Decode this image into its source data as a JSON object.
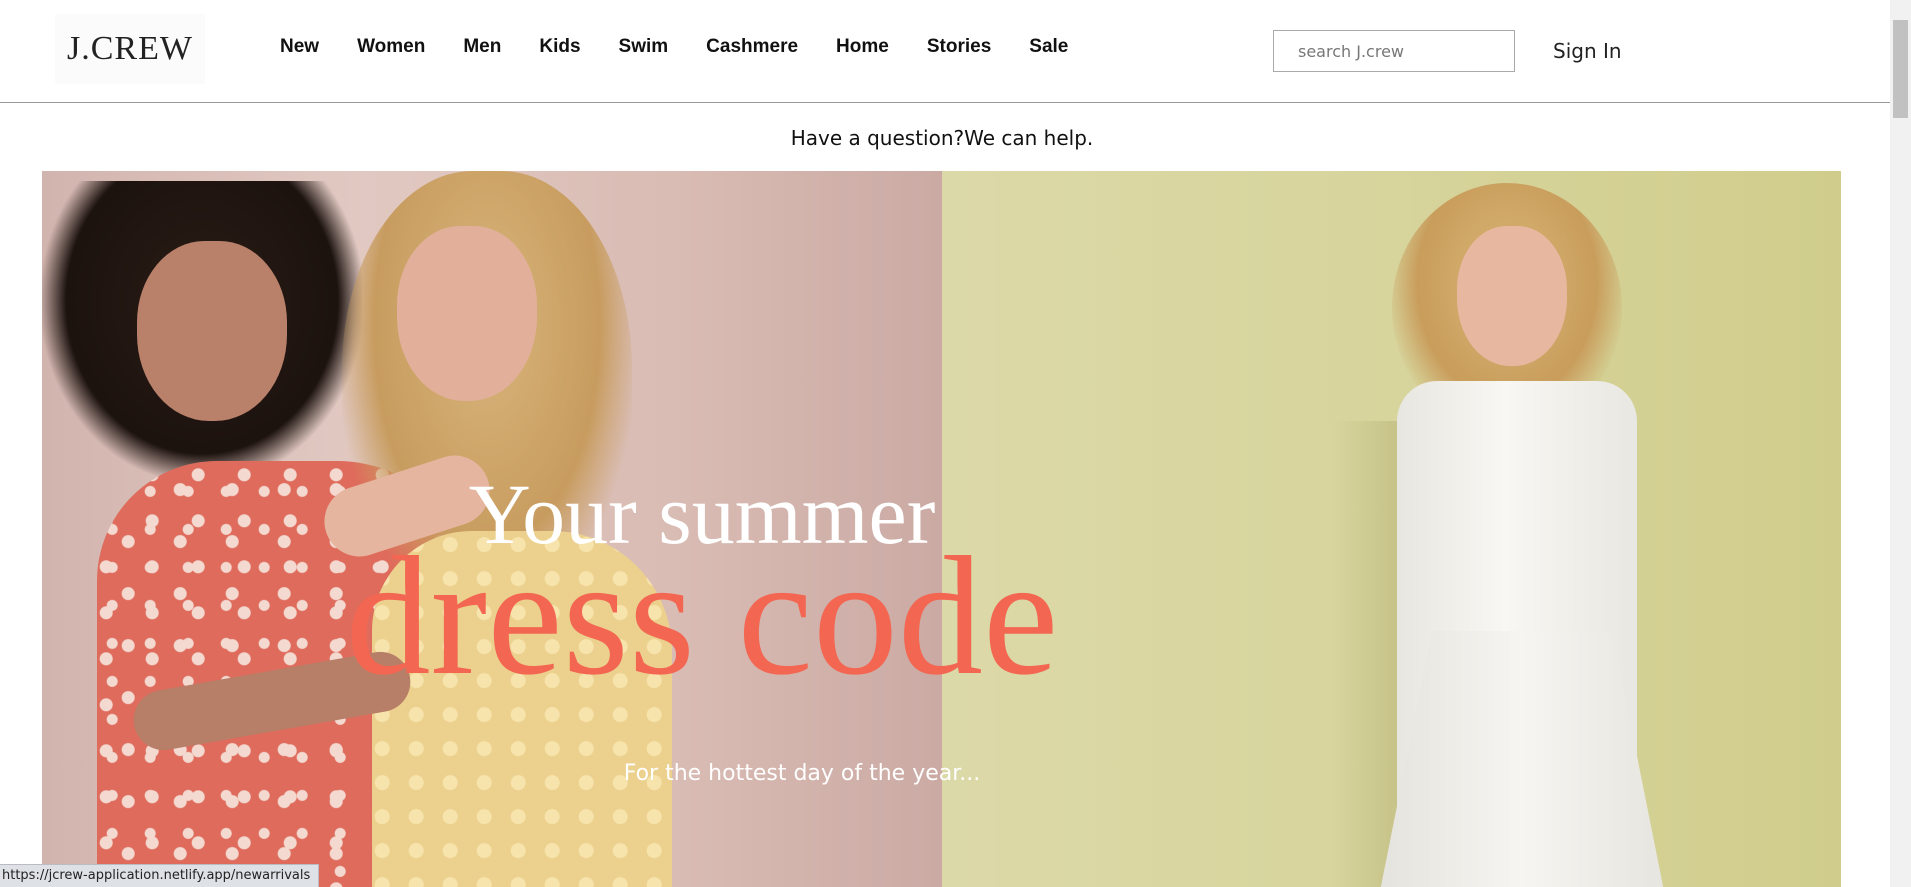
{
  "brand": {
    "logo_text": "J.CREW"
  },
  "nav": {
    "items": [
      {
        "label": "New"
      },
      {
        "label": "Women"
      },
      {
        "label": "Men"
      },
      {
        "label": "Kids"
      },
      {
        "label": "Swim"
      },
      {
        "label": "Cashmere"
      },
      {
        "label": "Home"
      },
      {
        "label": "Stories"
      },
      {
        "label": "Sale"
      }
    ]
  },
  "search": {
    "placeholder": "search J.crew",
    "value": ""
  },
  "account": {
    "signin_label": "Sign In"
  },
  "help": {
    "text": "Have a question?We can help."
  },
  "hero": {
    "headline_line1": "Your summer",
    "headline_line2": "dress code",
    "subheadline": "For the hottest day of the year...",
    "colors": {
      "left_bg": "#d9bcb4",
      "right_bg": "#d7d49c",
      "accent": "#f36752"
    }
  },
  "status_bar": {
    "url": "https://jcrew-application.netlify.app/newarrivals"
  }
}
